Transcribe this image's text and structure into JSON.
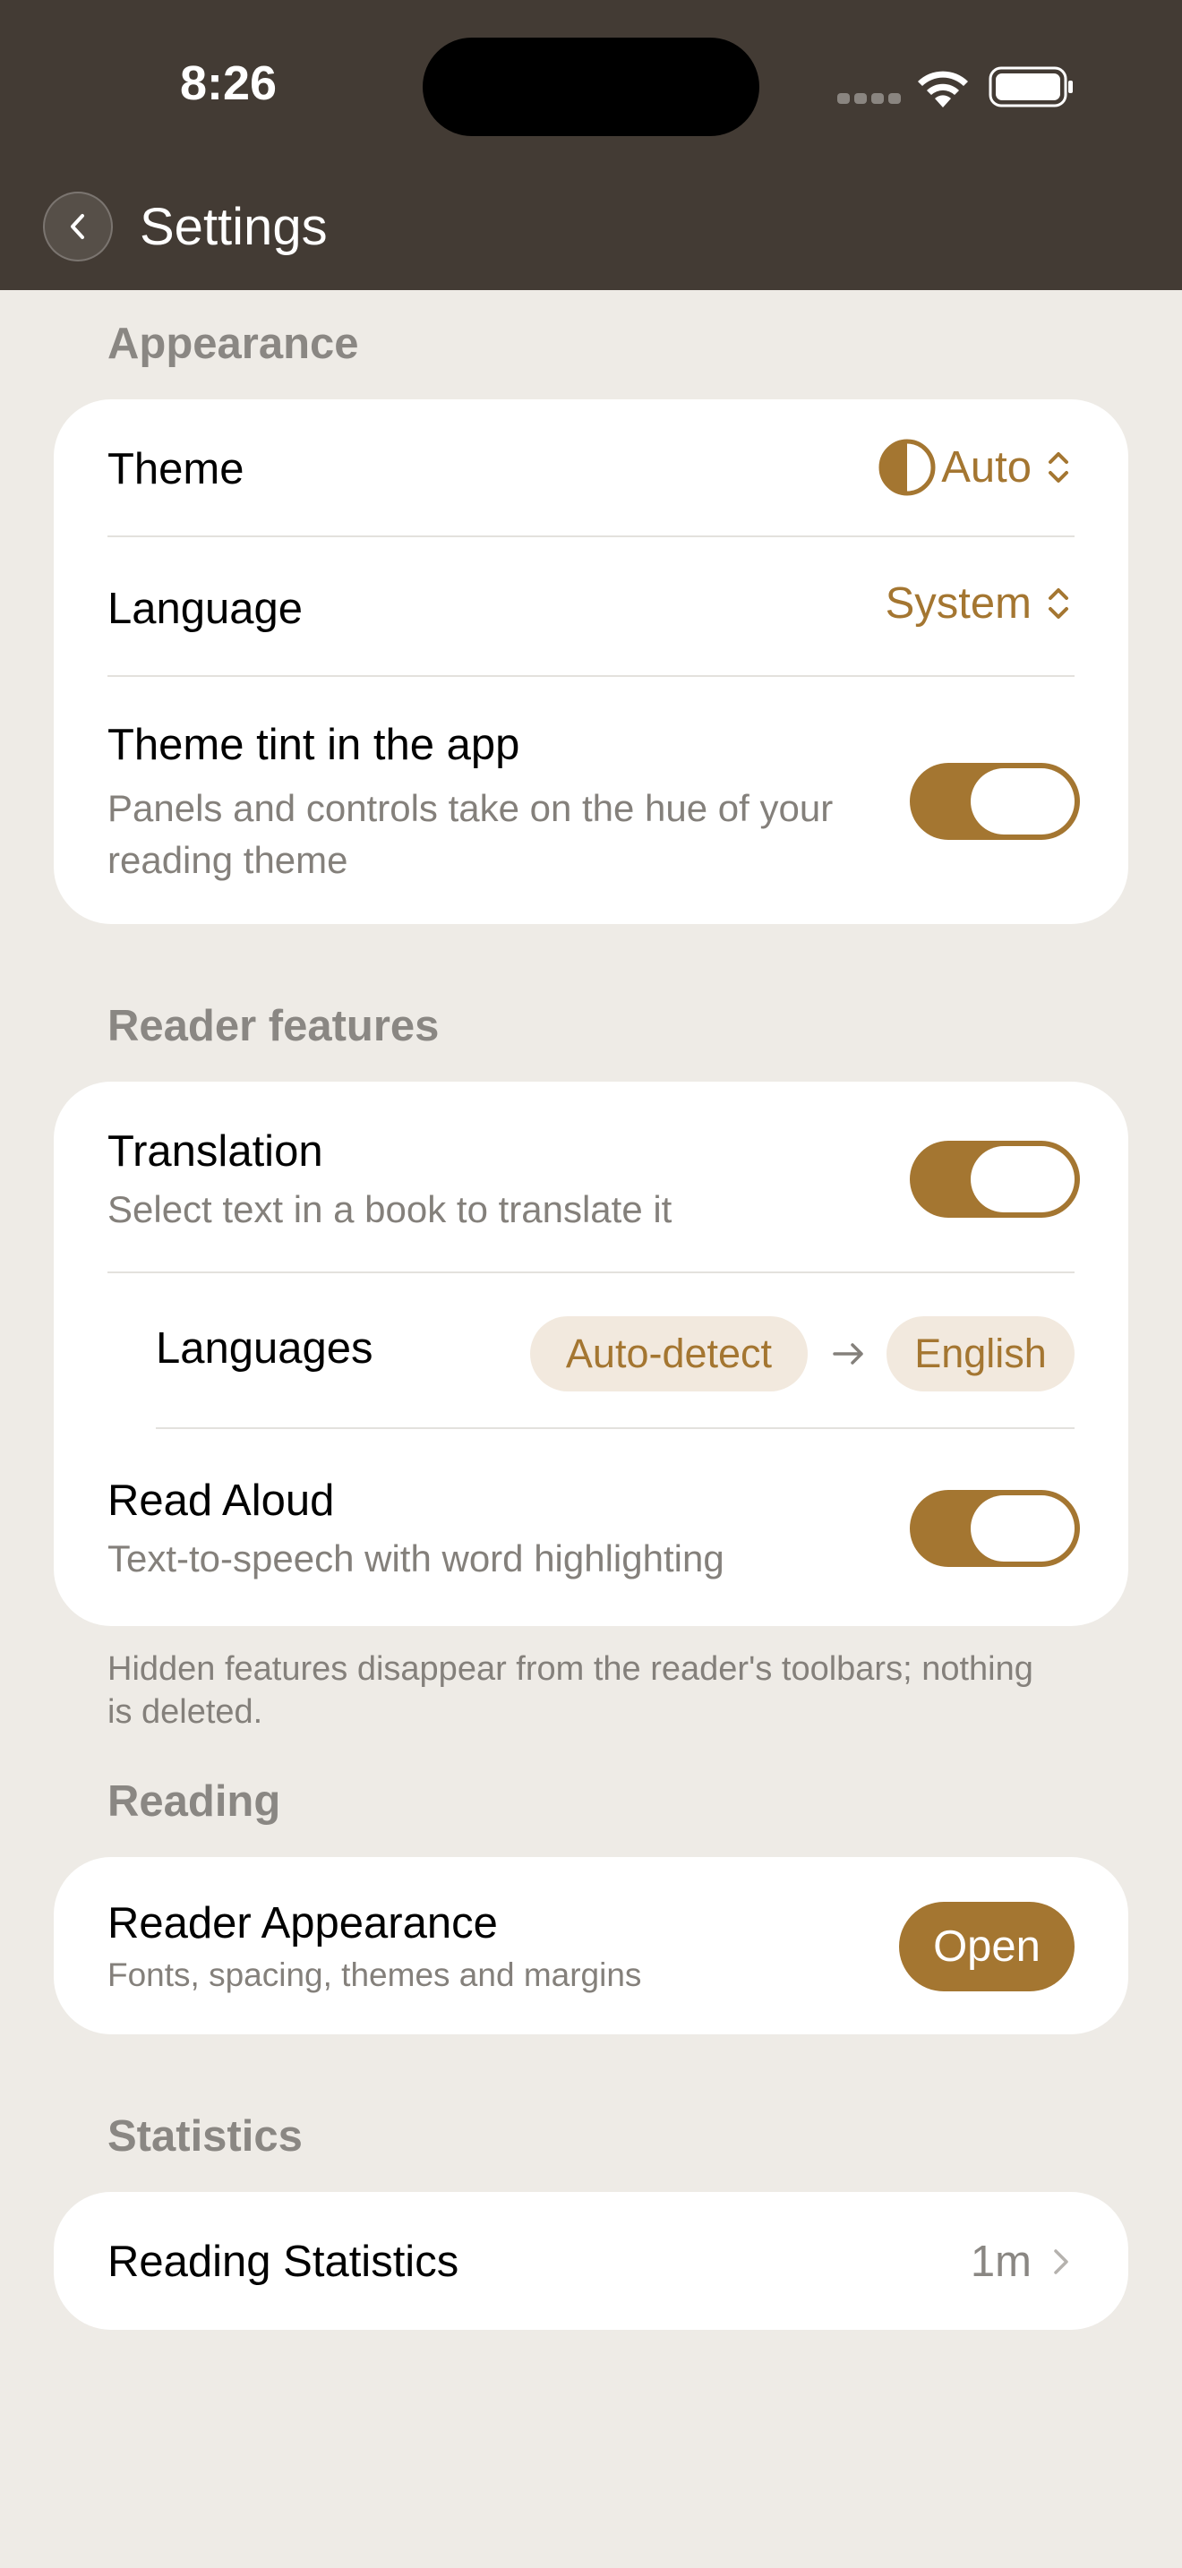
{
  "status_bar": {
    "time": "8:26"
  },
  "header": {
    "title": "Settings"
  },
  "appearance": {
    "section_title": "Appearance",
    "theme_label": "Theme",
    "theme_value": "Auto",
    "language_label": "Language",
    "language_value": "System",
    "tint_label": "Theme tint in the app",
    "tint_desc": "Panels and controls take on the hue of your reading theme",
    "tint_enabled": true
  },
  "reader_features": {
    "section_title": "Reader features",
    "translation_label": "Translation",
    "translation_desc": "Select text in a book to translate it",
    "translation_enabled": true,
    "languages_label": "Languages",
    "source_language": "Auto-detect",
    "target_language": "English",
    "read_aloud_label": "Read Aloud",
    "read_aloud_desc": "Text-to-speech with word highlighting",
    "read_aloud_enabled": true,
    "footnote": "Hidden features disappear from the reader's toolbars; nothing is deleted."
  },
  "reading": {
    "section_title": "Reading",
    "reader_appearance_label": "Reader Appearance",
    "reader_appearance_desc": "Fonts, spacing, themes and margins",
    "open_label": "Open"
  },
  "statistics": {
    "section_title": "Statistics",
    "reading_statistics_label": "Reading Statistics",
    "reading_statistics_value": "1m"
  },
  "colors": {
    "accent": "#A47631",
    "header_background": "#433B34",
    "page_background": "#EEEBE6",
    "pill_background": "#F2E9DE"
  }
}
